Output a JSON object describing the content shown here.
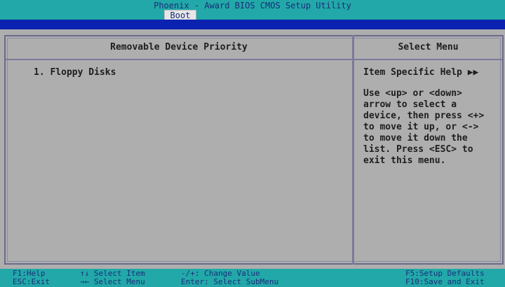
{
  "titlebar": {
    "title": "Phoenix - Award BIOS CMOS Setup Utility"
  },
  "menubar": {
    "active_tab": "Boot"
  },
  "left_panel": {
    "header": "Removable Device Priority",
    "devices": [
      "1. Floppy Disks"
    ]
  },
  "right_panel": {
    "header": "Select Menu",
    "help_title": "Item Specific Help ▶▶",
    "help_text": "Use <up> or <down>\narrow to select a\ndevice, then press <+>\nto move it up, or <->\nto move it down the\nlist. Press <ESC> to\nexit this menu."
  },
  "statusbar": {
    "row1": [
      "F1:Help",
      "↑↓ Select Item",
      "-/+: Change Value",
      "F5:Setup Defaults"
    ],
    "row2": [
      "ESC:Exit",
      "→← Select Menu",
      "Enter: Select SubMenu",
      "F10:Save and Exit"
    ]
  },
  "colors": {
    "cyan_bar": "#22a8a8",
    "menu_bar_blue": "#0b22b0",
    "panel_grey": "#aeaeae",
    "text_dark": "#1e1e1e",
    "status_text": "#1a2f7a"
  }
}
